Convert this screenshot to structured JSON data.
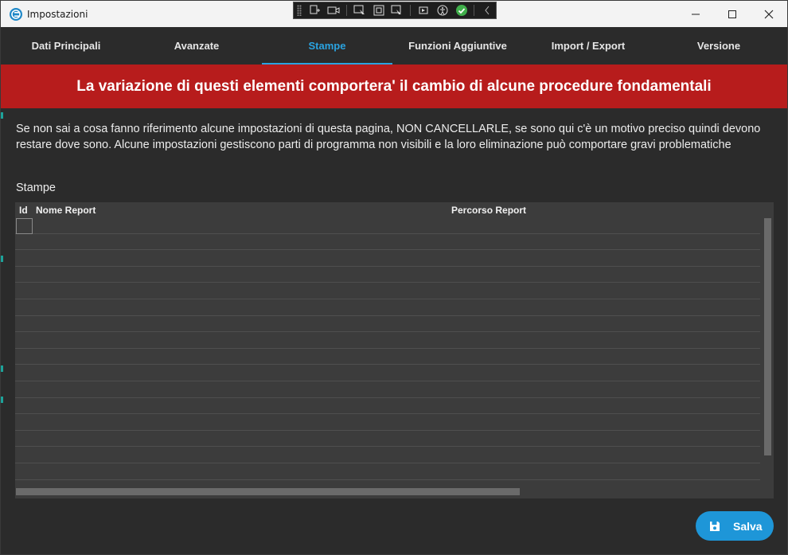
{
  "window": {
    "title": "Impostazioni",
    "controls": {
      "minimize": "–",
      "maximize": "☐",
      "close": "✕"
    }
  },
  "tabs": [
    {
      "label": "Dati Principali",
      "active": false
    },
    {
      "label": "Avanzate",
      "active": false
    },
    {
      "label": "Stampe",
      "active": true
    },
    {
      "label": "Funzioni Aggiuntive",
      "active": false
    },
    {
      "label": "Import / Export",
      "active": false
    },
    {
      "label": "Versione",
      "active": false
    }
  ],
  "banner": {
    "text": "La variazione di questi elementi comportera' il cambio di alcune procedure fondamentali",
    "color": "#b71c1c"
  },
  "info_text": "Se non sai a cosa fanno riferimento alcune impostazioni di questa pagina, NON CANCELLARLE, se sono qui c'è un motivo preciso quindi devono restare dove sono. Alcune impostazioni gestiscono parti di programma non visibili e la loro eliminazione può comportare gravi problematiche",
  "section_label": "Stampe",
  "grid": {
    "columns": [
      "Id",
      "Nome Report",
      "Percorso Report"
    ],
    "rows": []
  },
  "save_button": {
    "label": "Salva",
    "icon": "floppy-disk-icon",
    "color": "#1e96d8"
  },
  "accent_color": "#2aa3e0"
}
